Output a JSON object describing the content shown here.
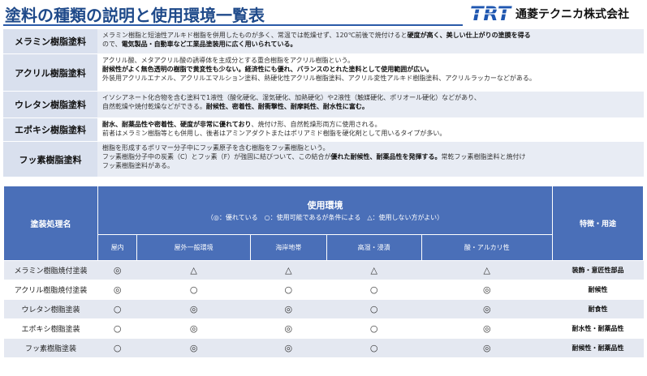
{
  "header": {
    "title": "塗料の種類の説明と使用環境一覧表",
    "logo_text": "TRT",
    "company": "通菱テクニカ株式会社"
  },
  "types": [
    {
      "name": "メラミン樹脂塗料",
      "desc_plain_1": "メラミン樹脂と短油性アルキド樹脂を併用したものが多く、常温では乾燥せず、120℃前後で焼付けると",
      "desc_bold_1": "硬度が高く、美しい仕上がりの塗膜を得る",
      "desc_plain_2": "ので、",
      "desc_bold_2": "電気製品・自動車など工業品塗装用に広く用いられている。"
    },
    {
      "name": "アクリル樹脂塗料",
      "line1": "アクリル酸、メタアクリル酸の誘導体を主成分とする重合樹脂をアクリル樹脂という。",
      "line2_bold": "耐候性がよく無色透明の樹脂で黄変性も少ない。経済性にも優れ、バランスのとれた塗料として使用範囲が広い。",
      "line3": "外装用アクリルエナメル、アクリルエマルション塗料、熱硬化性アクリル樹脂塗料、アクリル変性アルキド樹脂塗料、アクリルラッカーなどがある。"
    },
    {
      "name": "ウレタン樹脂塗料",
      "line1": "イソシアネート化合物を含む塗料で1液性（酸化硬化、湿気硬化、加熱硬化）や2液性（触媒硬化、ポリオール硬化）などがあり、",
      "line2_plain": "自然乾燥や焼付乾燥などができる。",
      "line2_bold": "耐候性、密着性、耐衝撃性、耐摩耗性、耐水性に富む。"
    },
    {
      "name": "エポキシ樹脂塗料",
      "line1_bold": "耐水、耐薬品性や密着性、硬度が非常に優れており",
      "line1_plain": "、焼付け形、自然乾燥形両方に使用される。",
      "line2": "前者はメラミン樹脂等とも併用し、後者はアミンアダクトまたはポリアミド樹脂を硬化剤として用いるタイプが多い。"
    },
    {
      "name": "フッ素樹脂塗料",
      "line1": "樹脂を形成するポリマー分子中にフッ素原子を含む樹脂をフッ素樹脂という。",
      "line2_plain": "フッ素樹脂分子中の炭素（C）とフッ素（F）が強固に結びついて、この結合が",
      "line2_bold": "優れた耐候性、耐薬品性を発揮する。",
      "line2_plain_b": "常乾フッ素樹脂塗料と焼付け",
      "line3": "フッ素樹脂塗料がある。"
    }
  ],
  "env_table": {
    "corner": "塗装処理名",
    "group_title": "使用環境",
    "legend": "（◎：優れている　○：使用可能であるが条件による　△：使用しない方がよい）",
    "features_header": "特徴・用途",
    "columns": [
      "屋内",
      "屋外一般環境",
      "海岸地帯",
      "高湿・浸漬",
      "酸・アルカリ性"
    ],
    "rows": [
      {
        "name": "メラミン樹脂焼付塗装",
        "marks": [
          "◎",
          "△",
          "△",
          "△",
          "△"
        ],
        "feature": "装飾・意匠性部品"
      },
      {
        "name": "アクリル樹脂焼付塗装",
        "marks": [
          "◎",
          "○",
          "○",
          "○",
          "◎"
        ],
        "feature": "耐候性"
      },
      {
        "name": "ウレタン樹脂塗装",
        "marks": [
          "○",
          "◎",
          "◎",
          "○",
          "◎"
        ],
        "feature": "耐食性"
      },
      {
        "name": "エポキシ樹脂塗装",
        "marks": [
          "○",
          "◎",
          "◎",
          "○",
          "◎"
        ],
        "feature": "耐水性・耐薬品性"
      },
      {
        "name": "フッ素樹脂塗装",
        "marks": [
          "○",
          "◎",
          "◎",
          "○",
          "◎"
        ],
        "feature": "耐候性・耐薬品性"
      }
    ]
  },
  "colors": {
    "title_blue": "#1f4a8a",
    "header_blue": "#4a6fb8",
    "label_bg": "#d9e0ee",
    "stripe": "#e4e8f1",
    "logo_blue": "#1e56b0"
  }
}
